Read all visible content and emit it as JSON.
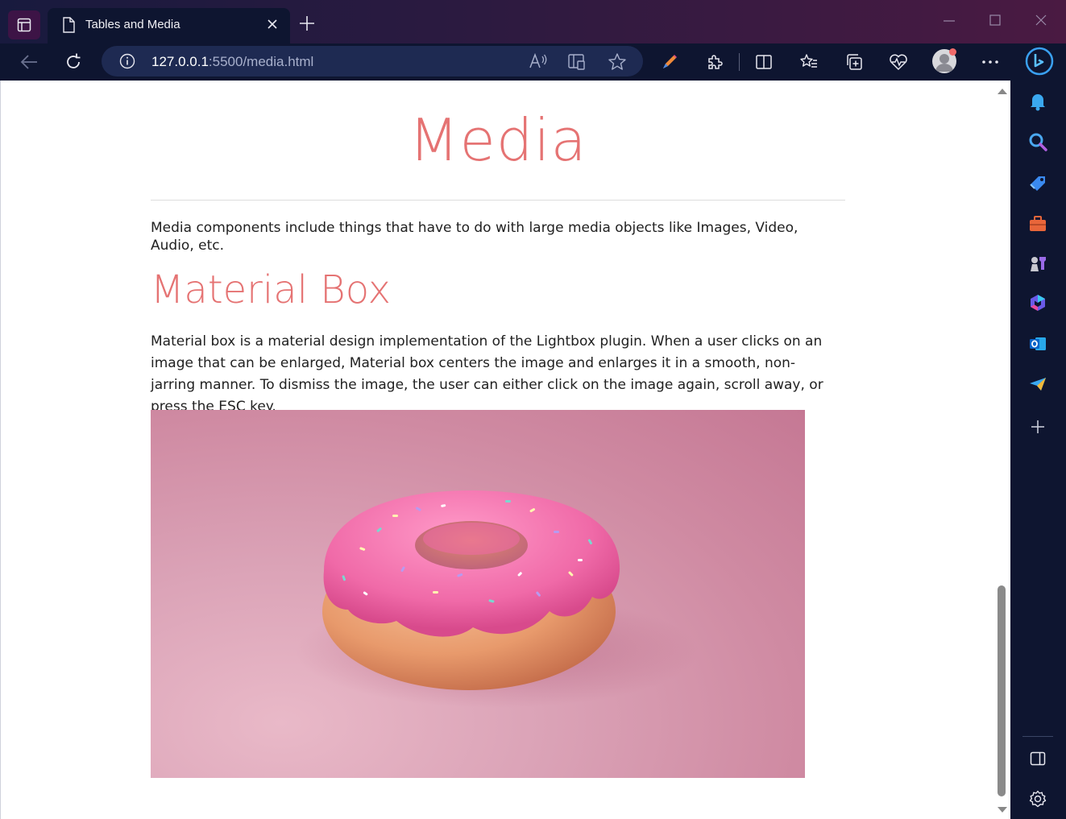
{
  "browser": {
    "tab": {
      "title": "Tables and Media"
    },
    "address": {
      "host": "127.0.0.1",
      "rest": ":5500/media.html"
    }
  },
  "page": {
    "title": "Media",
    "intro": "Media components include things that have to do with large media objects like Images, Video, Audio, etc.",
    "section": {
      "heading": "Material Box",
      "description": "Material box is a material design implementation of the Lightbox plugin. When a user clicks on an image that can be enlarged, Material box centers the image and enlarges it in a smooth, non-jarring manner. To dismiss the image, the user can either click on the image again, scroll away, or press the ESC key."
    }
  },
  "colors": {
    "heading": "#e57373",
    "frame": "#0e1530"
  },
  "icons": {
    "toolbar": [
      "back-icon",
      "refresh-icon",
      "info-icon",
      "read-aloud-icon",
      "app-available-icon",
      "favorite-star-icon",
      "pen-icon",
      "extensions-icon",
      "split-screen-icon",
      "favorites-icon",
      "collections-icon",
      "health-icon",
      "profile-avatar",
      "more-icon",
      "copilot-icon"
    ],
    "sidebar": [
      "bell-icon",
      "search-icon",
      "shopping-tag-icon",
      "tools-icon",
      "games-icon",
      "m365-icon",
      "outlook-icon",
      "telegram-icon",
      "add-icon",
      "sidebar-toggle-icon",
      "settings-icon"
    ]
  }
}
